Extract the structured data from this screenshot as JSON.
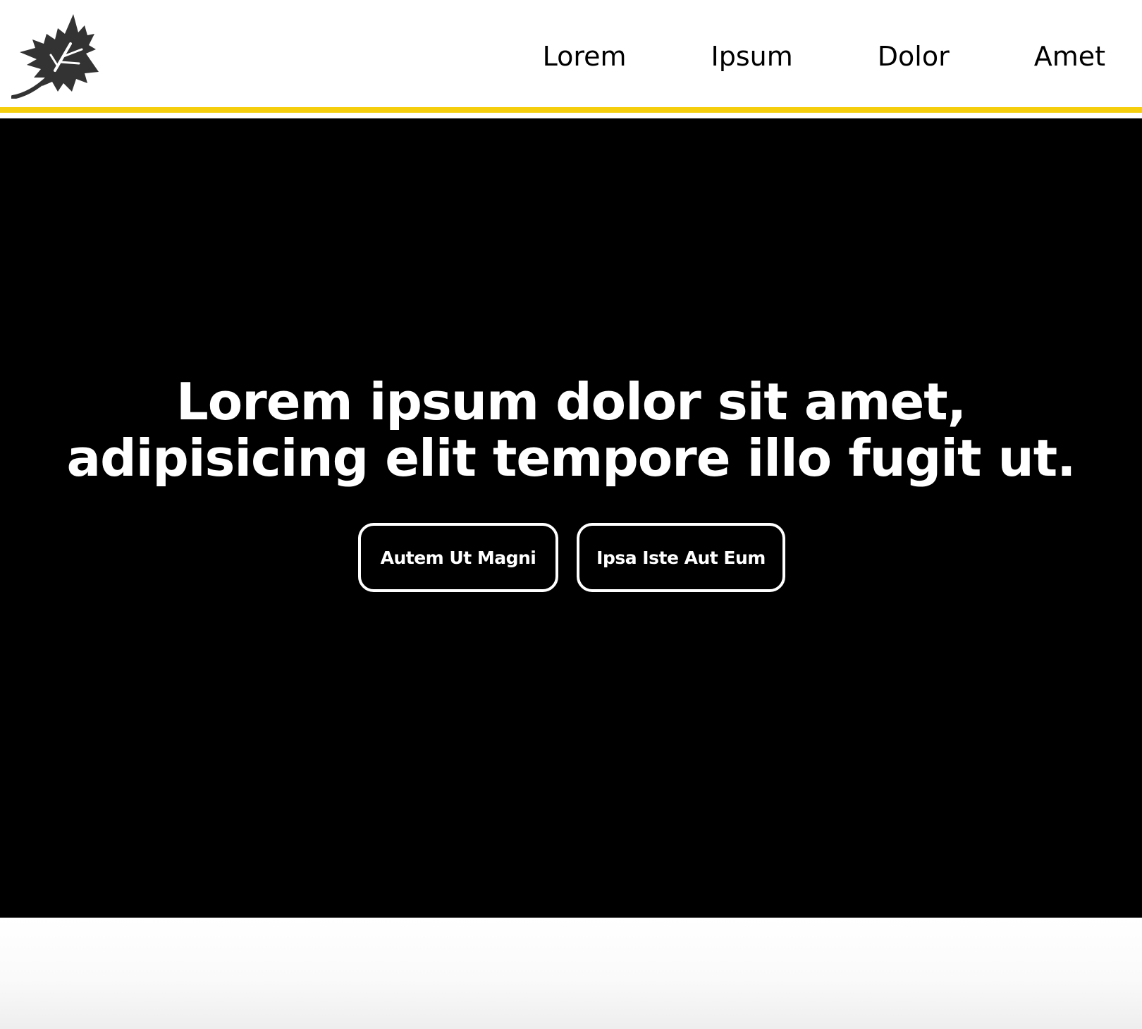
{
  "header": {
    "logo": "maple-leaf-icon",
    "accent_color": "#f5cf0e",
    "nav": [
      {
        "label": "Lorem"
      },
      {
        "label": "Ipsum"
      },
      {
        "label": "Dolor"
      },
      {
        "label": "Amet"
      }
    ]
  },
  "hero": {
    "background": "#000000",
    "title_line1": "Lorem ipsum dolor sit amet,",
    "title_line2": "adipisicing elit tempore illo fugit ut.",
    "buttons": [
      {
        "label": "Autem Ut Magni"
      },
      {
        "label": "Ipsa Iste Aut Eum"
      }
    ]
  }
}
